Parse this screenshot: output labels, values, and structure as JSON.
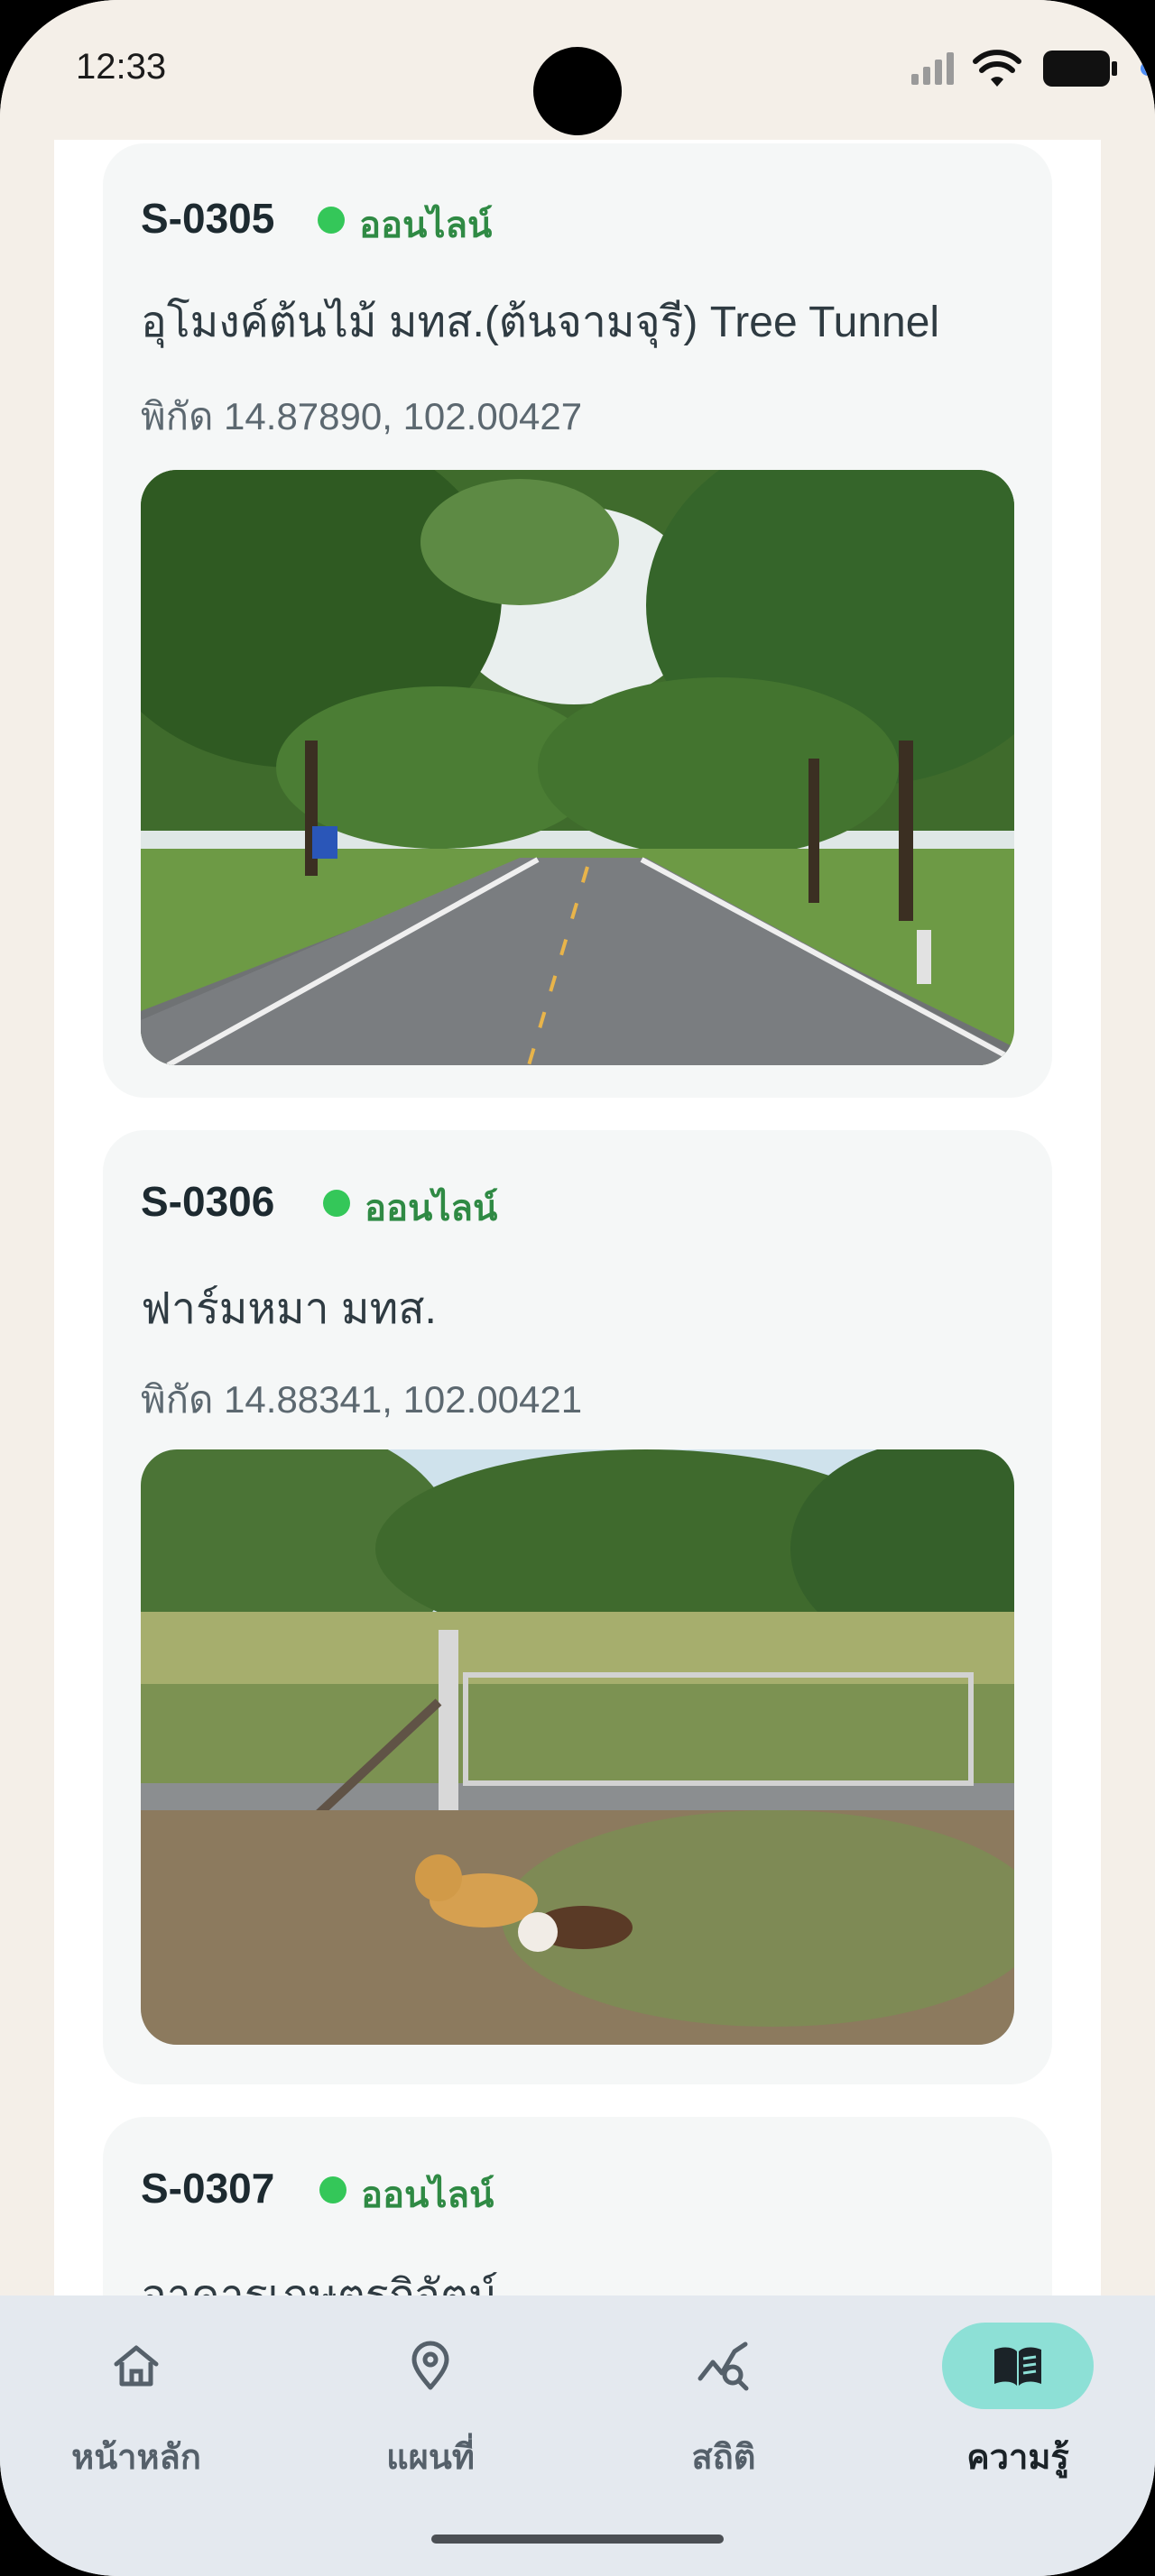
{
  "status_bar": {
    "time": "12:33"
  },
  "cards": [
    {
      "id": "S-0305",
      "status": "ออนไลน์",
      "name": "อุโมงค์ต้นไม้ มทส.(ต้นจามจุรี) Tree Tunnel",
      "coords": "พิกัด 14.87890, 102.00427",
      "photo_icon": "tree-tunnel-photo"
    },
    {
      "id": "S-0306",
      "status": "ออนไลน์",
      "name": "ฟาร์มหมา มทส.",
      "coords": "พิกัด 14.88341, 102.00421",
      "photo_icon": "dog-farm-photo"
    },
    {
      "id": "S-0307",
      "status": "ออนไลน์",
      "name": "อาคารเกษตรกิจัตน์"
    }
  ],
  "nav": {
    "items": [
      {
        "label": "หน้าหลัก",
        "icon": "home-icon"
      },
      {
        "label": "แผนที่",
        "icon": "map-pin-icon"
      },
      {
        "label": "สถิติ",
        "icon": "stats-icon"
      },
      {
        "label": "ความรู้",
        "icon": "book-icon",
        "active": true
      }
    ]
  },
  "colors": {
    "online": "#34c759",
    "active_tab": "#8de0d6",
    "background": "#f4efe8"
  }
}
